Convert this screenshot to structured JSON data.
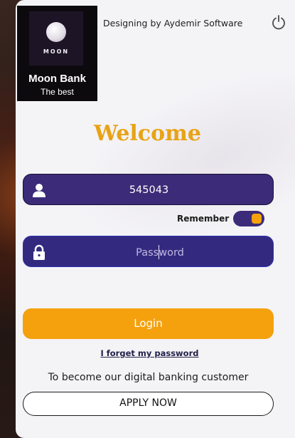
{
  "brand": {
    "logo_text": "MOON",
    "name": "Moon Bank",
    "tagline": "The best"
  },
  "header": {
    "designer_credit": "Designing by Aydemir Software",
    "power_icon": "power-icon"
  },
  "welcome": "Welcome",
  "login_form": {
    "customer_number_value": "545043",
    "user_icon": "user-icon",
    "password_placeholder": "Password",
    "lock_icon": "lock-icon",
    "remember_label": "Remember",
    "remember_on": true,
    "login_label": "Login",
    "forgot_password_label": "I forget my password"
  },
  "signup": {
    "prompt": "To become our digital banking customer",
    "apply_label": "APPLY NOW"
  },
  "colors": {
    "accent_orange": "#f4a10d",
    "welcome_gold": "#e8a315",
    "field_purple": "#3c2b78",
    "logo_background": "#0c0a0d"
  }
}
